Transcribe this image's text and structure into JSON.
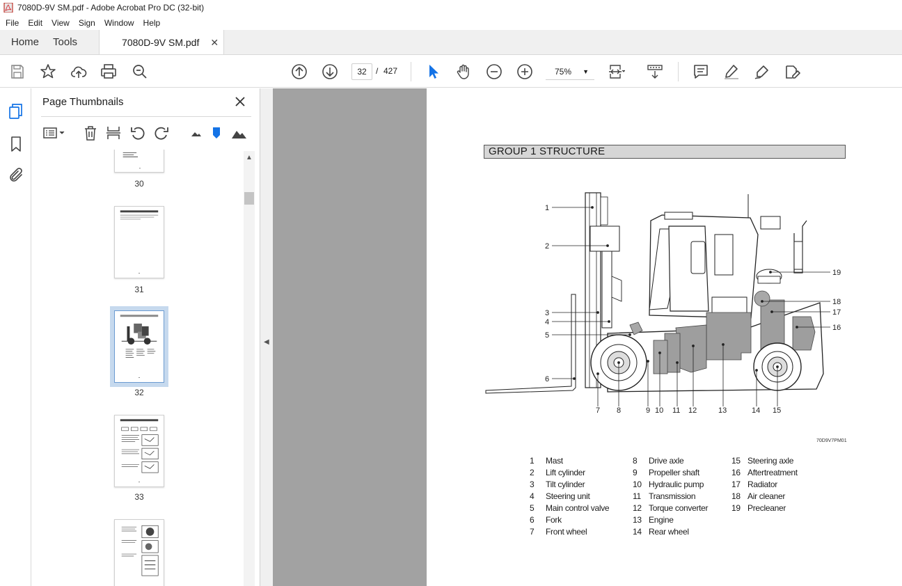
{
  "window": {
    "title": "7080D-9V SM.pdf - Adobe Acrobat Pro DC (32-bit)"
  },
  "menu": [
    "File",
    "Edit",
    "View",
    "Sign",
    "Window",
    "Help"
  ],
  "tabs": {
    "home": "Home",
    "tools": "Tools",
    "document": "7080D-9V SM.pdf"
  },
  "toolbar": {
    "current_page": "32",
    "separator": "/",
    "total_pages": "427",
    "zoom": "75%"
  },
  "thumbnails": {
    "title": "Page Thumbnails",
    "pages": [
      "30",
      "31",
      "32",
      "33",
      ""
    ],
    "selected": "32"
  },
  "document": {
    "header": "GROUP  1  STRUCTURE",
    "figure_code": "70D9V7PM01",
    "callouts": [
      "1",
      "2",
      "3",
      "4",
      "5",
      "6",
      "7",
      "8",
      "9",
      "10",
      "11",
      "12",
      "13",
      "14",
      "15",
      "16",
      "17",
      "18",
      "19"
    ],
    "legend": [
      {
        "num": "1",
        "label": "Mast"
      },
      {
        "num": "2",
        "label": "Lift cylinder"
      },
      {
        "num": "3",
        "label": "Tilt cylinder"
      },
      {
        "num": "4",
        "label": "Steering unit"
      },
      {
        "num": "5",
        "label": "Main control valve"
      },
      {
        "num": "6",
        "label": "Fork"
      },
      {
        "num": "7",
        "label": "Front wheel"
      },
      {
        "num": "8",
        "label": "Drive axle"
      },
      {
        "num": "9",
        "label": "Propeller shaft"
      },
      {
        "num": "10",
        "label": "Hydraulic pump"
      },
      {
        "num": "11",
        "label": "Transmission"
      },
      {
        "num": "12",
        "label": "Torque converter"
      },
      {
        "num": "13",
        "label": "Engine"
      },
      {
        "num": "14",
        "label": "Rear wheel"
      },
      {
        "num": "15",
        "label": "Steering axle"
      },
      {
        "num": "16",
        "label": "Aftertreatment"
      },
      {
        "num": "17",
        "label": "Radiator"
      },
      {
        "num": "18",
        "label": "Air cleaner"
      },
      {
        "num": "19",
        "label": "Precleaner"
      }
    ]
  },
  "colors": {
    "accent": "#1473e6",
    "viewer_bg": "#a2a2a2",
    "selection": "#c6d9ee"
  }
}
